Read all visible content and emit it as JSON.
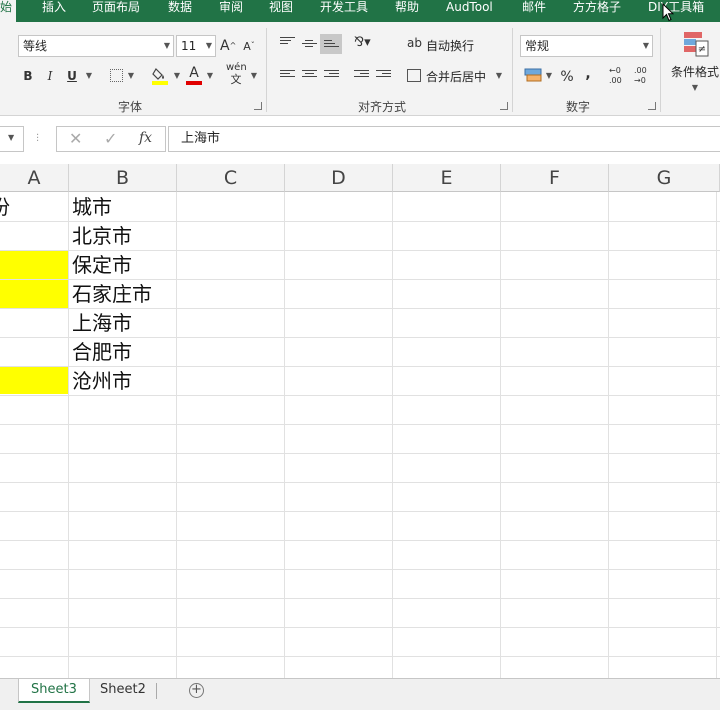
{
  "tabs": [
    {
      "label": "始",
      "active": true
    },
    {
      "label": "插入"
    },
    {
      "label": "页面布局"
    },
    {
      "label": "数据"
    },
    {
      "label": "审阅"
    },
    {
      "label": "视图"
    },
    {
      "label": "开发工具"
    },
    {
      "label": "帮助"
    },
    {
      "label": "AudTool"
    },
    {
      "label": "邮件"
    },
    {
      "label": "方方格子"
    },
    {
      "label": "DIY工具箱"
    }
  ],
  "ribbon": {
    "font": {
      "name": "等线",
      "size": "11",
      "grow_label": "A",
      "shrink_label": "A",
      "bold": "B",
      "italic": "I",
      "underline": "U",
      "font_color_label": "A",
      "phonetic_label": "wén",
      "group_label": "字体",
      "fill_color": "#ffff00",
      "font_color": "#e00000"
    },
    "alignment": {
      "wrap_text": "自动换行",
      "merge_center": "合并后居中",
      "group_label": "对齐方式"
    },
    "number": {
      "format": "常规",
      "percent": "%",
      "comma": ",",
      "inc_decimal_top": "←0",
      "inc_decimal_bottom": ".00",
      "dec_decimal_top": ".00",
      "dec_decimal_bottom": "→0",
      "group_label": "数字"
    },
    "styles": {
      "conditional_format": "条件格式"
    }
  },
  "formula_bar": {
    "fx_label": "fx",
    "value": "上海市"
  },
  "grid": {
    "columns": [
      "A",
      "B",
      "C",
      "D",
      "E",
      "F",
      "G"
    ],
    "rows": [
      {
        "a": "份",
        "b": "城市",
        "a_fill": false
      },
      {
        "a": "",
        "b": "北京市",
        "a_fill": false
      },
      {
        "a": "",
        "b": "保定市",
        "a_fill": true
      },
      {
        "a": "",
        "b": "石家庄市",
        "a_fill": true
      },
      {
        "a": "",
        "b": "上海市",
        "a_fill": false
      },
      {
        "a": "",
        "b": "合肥市",
        "a_fill": false
      },
      {
        "a": "",
        "b": "沧州市",
        "a_fill": true
      }
    ],
    "highlight_color": "#ffff00"
  },
  "sheets": [
    {
      "label": "Sheet3",
      "active": true
    },
    {
      "label": "Sheet2",
      "active": false
    }
  ],
  "accent": "#217346"
}
